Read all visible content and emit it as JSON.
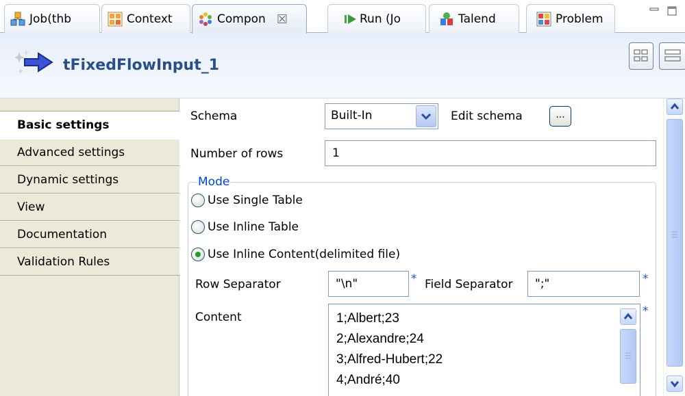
{
  "tabs": [
    {
      "label": "Job(thb",
      "icon": "job-icon"
    },
    {
      "label": "Context",
      "icon": "context-icon"
    },
    {
      "label": "Compon",
      "icon": "component-icon",
      "active": true,
      "close": "☒"
    },
    {
      "label": "Run (Jo",
      "icon": "run-icon"
    },
    {
      "label": "Talend",
      "icon": "talend-icon"
    },
    {
      "label": "Problem",
      "icon": "problem-icon"
    }
  ],
  "component": {
    "title": "tFixedFlowInput_1",
    "icon": "flow-arrow-icon"
  },
  "nav": {
    "items": [
      {
        "label": "Basic settings",
        "selected": true
      },
      {
        "label": "Advanced settings"
      },
      {
        "label": "Dynamic settings"
      },
      {
        "label": "View"
      },
      {
        "label": "Documentation"
      },
      {
        "label": "Validation Rules"
      }
    ]
  },
  "form": {
    "schema_label": "Schema",
    "schema_value": "Built-In",
    "edit_schema_label": "Edit schema",
    "edit_schema_button": "...",
    "rows_label": "Number of rows",
    "rows_value": "1",
    "mode_legend": "Mode",
    "mode_options": [
      {
        "label": "Use Single Table",
        "checked": false
      },
      {
        "label": "Use Inline Table",
        "checked": false
      },
      {
        "label": "Use Inline Content(delimited file)",
        "checked": true
      }
    ],
    "row_sep_label": "Row Separator",
    "row_sep_value": "\"\\n\"",
    "field_sep_label": "Field Separator",
    "field_sep_value": "\";\"",
    "required_marker": "*",
    "content_label": "Content",
    "content_lines": [
      "1;Albert;23",
      "2;Alexandre;24",
      "3;Alfred-Hubert;22",
      "4;André;40"
    ]
  },
  "colors": {
    "title": "#2a4e8a",
    "legend": "#0046d5",
    "required": "#2050c8",
    "nav_bg": "#ece9d8"
  }
}
